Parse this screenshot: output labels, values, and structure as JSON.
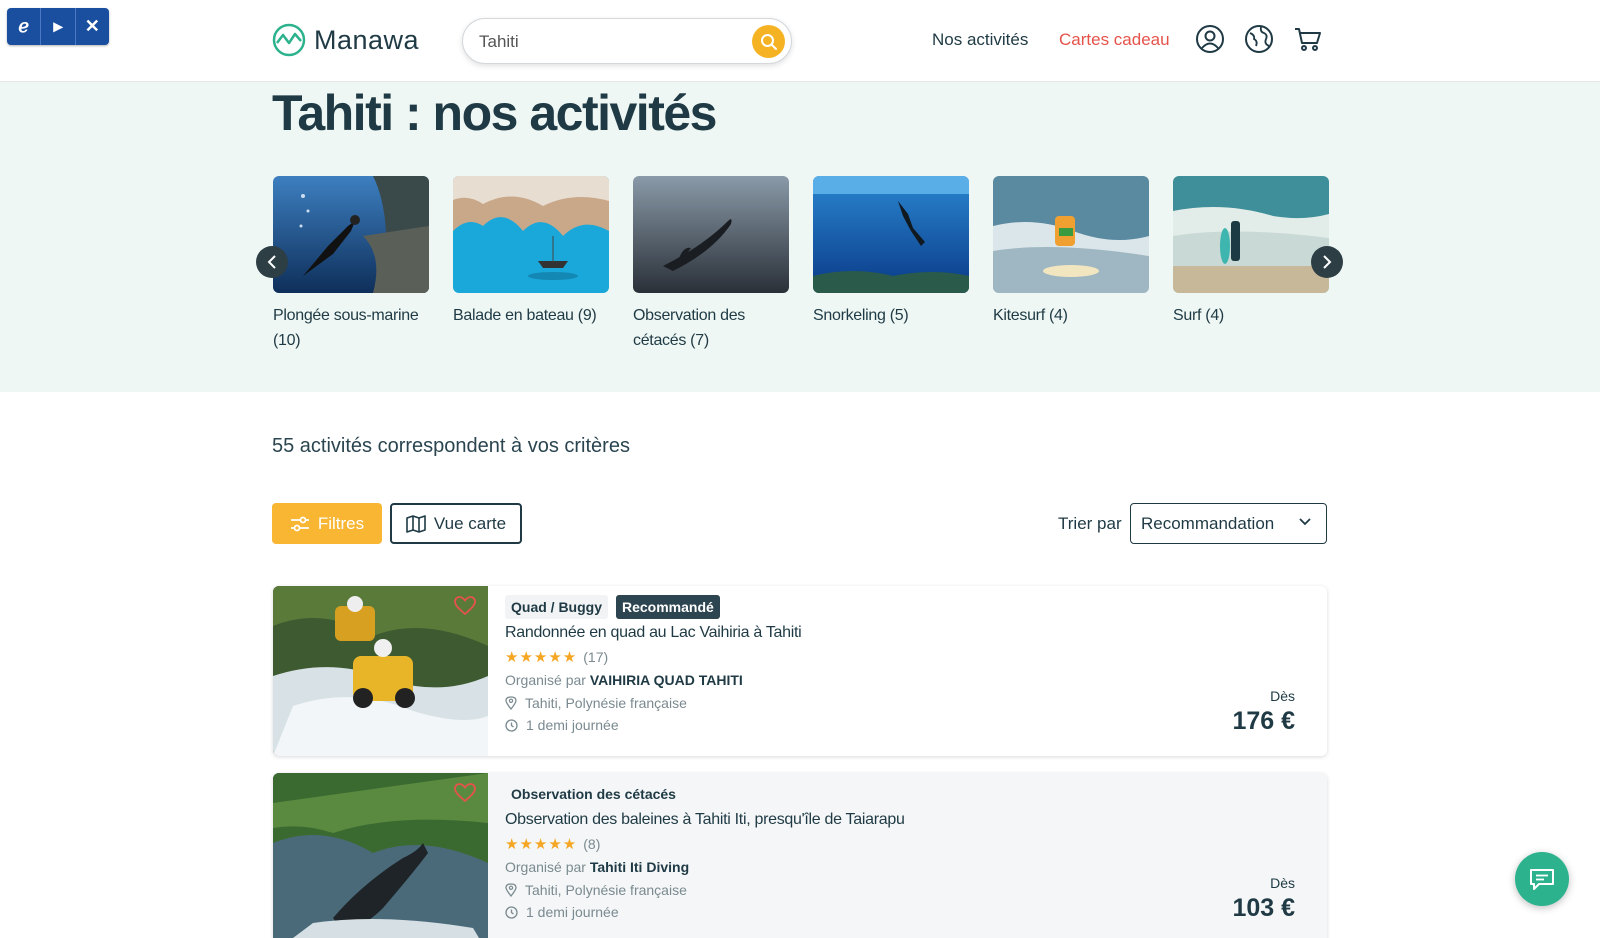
{
  "extension": {
    "b_icon": "ℯ",
    "play_icon": "▸",
    "close_icon": "✕"
  },
  "header": {
    "brand": "Manawa",
    "search": {
      "value": "Tahiti",
      "placeholder": ""
    },
    "nav": {
      "activities": "Nos activités",
      "gift_cards": "Cartes cadeau"
    },
    "icons": [
      "account-icon",
      "language-globe-icon",
      "cart-icon"
    ]
  },
  "hero": {
    "title": "Tahiti : nos activités",
    "categories": [
      {
        "label": "Plongée sous-marine (10)"
      },
      {
        "label": "Balade en bateau (9)"
      },
      {
        "label": "Observation des cétacés (7)"
      },
      {
        "label": "Snorkeling (5)"
      },
      {
        "label": "Kitesurf (4)"
      },
      {
        "label": "Surf (4)"
      }
    ]
  },
  "results": {
    "count_text": "55 activités correspondent à vos critères",
    "filter_label": "Filtres",
    "map_label": "Vue carte",
    "sort_label": "Trier par",
    "sort_value": "Recommandation"
  },
  "activities": [
    {
      "category": "Quad / Buggy",
      "badge": "Recommandé",
      "title": "Randonnée en quad au Lac Vaihiria à Tahiti",
      "rating": 5,
      "reviews": "(17)",
      "organizer_prefix": "Organisé par",
      "organizer": "VAIHIRIA QUAD TAHITI",
      "location": "Tahiti, Polynésie française",
      "duration": "1 demi journée",
      "price_from": "Dès",
      "price": "176 €"
    },
    {
      "category": "Observation des cétacés",
      "badge": "",
      "title": "Observation des baleines à Tahiti Iti, presqu'île de Taiarapu",
      "rating": 5,
      "reviews": "(8)",
      "organizer_prefix": "Organisé par",
      "organizer": "Tahiti Iti Diving",
      "location": "Tahiti, Polynésie française",
      "duration": "1 demi journée",
      "price_from": "Dès",
      "price": "103 €"
    }
  ],
  "colors": {
    "accent": "#f8b632",
    "gift": "#e5534b",
    "chat": "#2cb38e",
    "dark": "#1f3a44",
    "hero_bg": "#eef7f4"
  }
}
